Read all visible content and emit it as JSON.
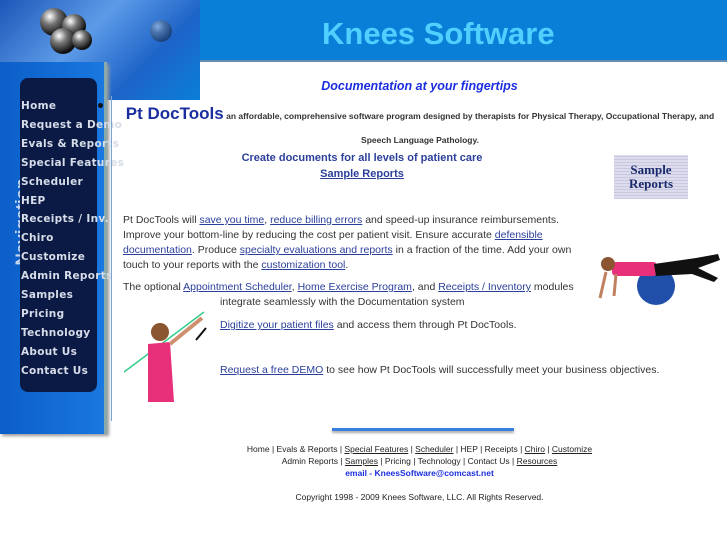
{
  "header": {
    "title": "Knees Software"
  },
  "sidebar": {
    "heading": "Navigation",
    "items": [
      "Home",
      "Request a Demo",
      "Evals & Reports",
      "Special Features",
      "Scheduler",
      "HEP",
      "Receipts / Inv.",
      "Chiro",
      "Customize",
      "Admin Reports",
      "Samples",
      "Pricing",
      "Technology",
      "About Us",
      "Contact Us"
    ]
  },
  "main": {
    "tagline": "Documentation at your fingertips",
    "product": "Pt DocTools",
    "product_desc": "an affordable, comprehensive software program designed by therapists for Physical Therapy, Occupational Therapy, and Speech Language Pathology.",
    "create": "Create documents for all levels of patient care",
    "sample_link": "Sample Reports",
    "sample_badge": "Sample Reports",
    "p1": {
      "t1": "Pt DocTools will ",
      "l1": "save you time",
      "t2": ", ",
      "l2": "reduce billing errors",
      "t3": " and speed-up insurance reimbursements. Improve your bottom-line by reducing the cost per patient visit.  Ensure accurate ",
      "l3": "defensible documentation",
      "t4": ".  Produce ",
      "l4": "specialty evaluations and reports",
      "t5": " in a fraction of the time.  Add your own touch to your reports with the ",
      "l5": "customization tool",
      "t6": "."
    },
    "p2": {
      "t1": "The optional ",
      "l1": "Appointment Scheduler",
      "t2": ", ",
      "l2": "Home Exercise Program",
      "t3": ", and ",
      "l3": "Receipts / Inventory",
      "t4": " modules",
      "t5": "integrate seamlessly with the Documentation system"
    },
    "p3": {
      "l1": "Digitize your patient files",
      "t1": " and access them through Pt DocTools."
    },
    "p4": {
      "l1": "Request a free DEMO",
      "t1": " to see how Pt DocTools will successfully meet your business objectives."
    }
  },
  "footer": {
    "row1": [
      {
        "t": "Home",
        "link": false
      },
      {
        "t": "Evals & Reports",
        "link": false
      },
      {
        "t": "Special Features",
        "link": true
      },
      {
        "t": "Scheduler",
        "link": true
      },
      {
        "t": "HEP",
        "link": false
      },
      {
        "t": "Receipts",
        "link": false
      },
      {
        "t": "Chiro",
        "link": true
      },
      {
        "t": "Customize",
        "link": true
      }
    ],
    "row2": [
      {
        "t": "Admin Reports",
        "link": false
      },
      {
        "t": "Samples",
        "link": true
      },
      {
        "t": "Pricing",
        "link": false
      },
      {
        "t": "Technology",
        "link": false
      },
      {
        "t": "Contact Us",
        "link": false
      },
      {
        "t": "Resources",
        "link": true
      }
    ],
    "email": "email - KneesSoftware@comcast.net",
    "copyright": "Copyright 1998 - 2009 Knees Software, LLC.  All Rights Reserved."
  }
}
